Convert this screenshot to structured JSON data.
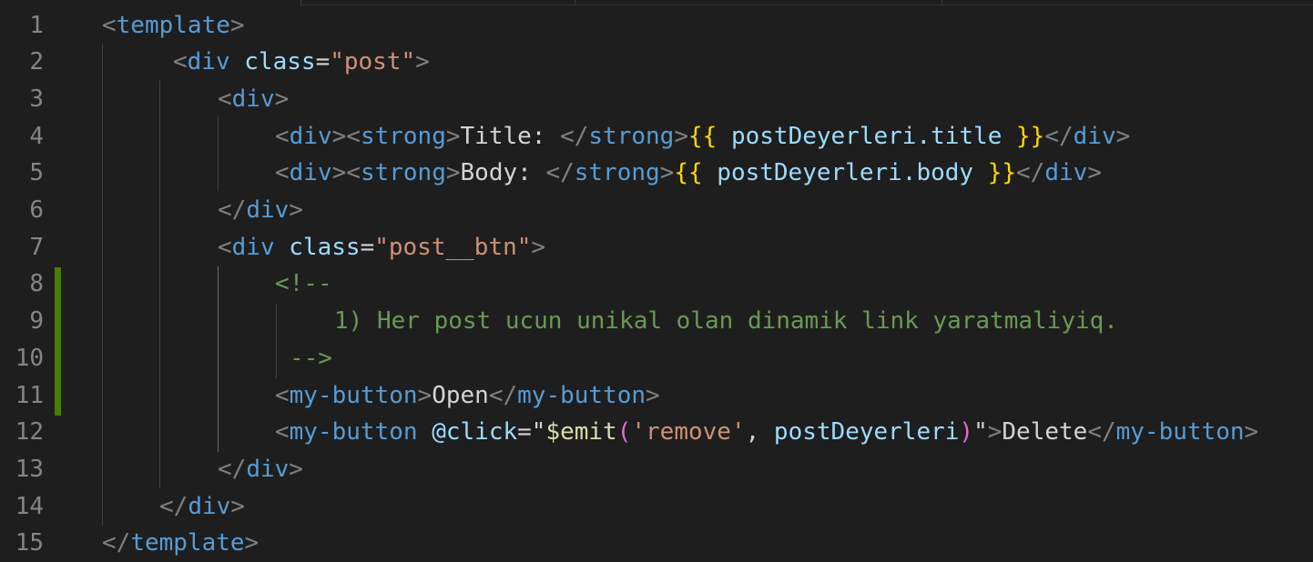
{
  "line_numbers": [
    "1",
    "2",
    "3",
    "4",
    "5",
    "6",
    "7",
    "8",
    "9",
    "10",
    "11",
    "12",
    "13",
    "14",
    "15"
  ],
  "lines": [
    [
      {
        "t": "<",
        "c": "t-bracket"
      },
      {
        "t": "template",
        "c": "t-tag"
      },
      {
        "t": ">",
        "c": "t-bracket"
      }
    ],
    [
      {
        "t": "<",
        "c": "t-bracket"
      },
      {
        "t": "div",
        "c": "t-tag"
      },
      {
        "t": " ",
        "c": "t-text"
      },
      {
        "t": "class",
        "c": "t-attr"
      },
      {
        "t": "=",
        "c": "t-text"
      },
      {
        "t": "\"post\"",
        "c": "t-str"
      },
      {
        "t": ">",
        "c": "t-bracket"
      }
    ],
    [
      {
        "t": "<",
        "c": "t-bracket"
      },
      {
        "t": "div",
        "c": "t-tag"
      },
      {
        "t": ">",
        "c": "t-bracket"
      }
    ],
    [
      {
        "t": "<",
        "c": "t-bracket"
      },
      {
        "t": "div",
        "c": "t-tag"
      },
      {
        "t": "><",
        "c": "t-bracket"
      },
      {
        "t": "strong",
        "c": "t-tag"
      },
      {
        "t": ">",
        "c": "t-bracket"
      },
      {
        "t": "Title: ",
        "c": "t-text"
      },
      {
        "t": "</",
        "c": "t-bracket"
      },
      {
        "t": "strong",
        "c": "t-tag"
      },
      {
        "t": ">",
        "c": "t-bracket"
      },
      {
        "t": "{{",
        "c": "t-mus"
      },
      {
        "t": " postDeyerleri.title ",
        "c": "t-var"
      },
      {
        "t": "}}",
        "c": "t-mus"
      },
      {
        "t": "</",
        "c": "t-bracket"
      },
      {
        "t": "div",
        "c": "t-tag"
      },
      {
        "t": ">",
        "c": "t-bracket"
      }
    ],
    [
      {
        "t": "<",
        "c": "t-bracket"
      },
      {
        "t": "div",
        "c": "t-tag"
      },
      {
        "t": "><",
        "c": "t-bracket"
      },
      {
        "t": "strong",
        "c": "t-tag"
      },
      {
        "t": ">",
        "c": "t-bracket"
      },
      {
        "t": "Body: ",
        "c": "t-text"
      },
      {
        "t": "</",
        "c": "t-bracket"
      },
      {
        "t": "strong",
        "c": "t-tag"
      },
      {
        "t": ">",
        "c": "t-bracket"
      },
      {
        "t": "{{",
        "c": "t-mus"
      },
      {
        "t": " postDeyerleri.body ",
        "c": "t-var"
      },
      {
        "t": "}}",
        "c": "t-mus"
      },
      {
        "t": "</",
        "c": "t-bracket"
      },
      {
        "t": "div",
        "c": "t-tag"
      },
      {
        "t": ">",
        "c": "t-bracket"
      }
    ],
    [
      {
        "t": "</",
        "c": "t-bracket"
      },
      {
        "t": "div",
        "c": "t-tag"
      },
      {
        "t": ">",
        "c": "t-bracket"
      }
    ],
    [
      {
        "t": "<",
        "c": "t-bracket"
      },
      {
        "t": "div",
        "c": "t-tag"
      },
      {
        "t": " ",
        "c": "t-text"
      },
      {
        "t": "class",
        "c": "t-attr"
      },
      {
        "t": "=",
        "c": "t-text"
      },
      {
        "t": "\"post__btn\"",
        "c": "t-str"
      },
      {
        "t": ">",
        "c": "t-bracket"
      }
    ],
    [
      {
        "t": "<!--",
        "c": "t-com"
      }
    ],
    [
      {
        "t": "1) Her post ucun unikal olan dinamik link yaratmaliyiq.",
        "c": "t-com"
      }
    ],
    [
      {
        "t": "-->",
        "c": "t-com"
      }
    ],
    [
      {
        "t": "<",
        "c": "t-bracket"
      },
      {
        "t": "my-button",
        "c": "t-tag"
      },
      {
        "t": ">",
        "c": "t-bracket"
      },
      {
        "t": "Open",
        "c": "t-text"
      },
      {
        "t": "</",
        "c": "t-bracket"
      },
      {
        "t": "my-button",
        "c": "t-tag"
      },
      {
        "t": ">",
        "c": "t-bracket"
      }
    ],
    [
      {
        "t": "<",
        "c": "t-bracket"
      },
      {
        "t": "my-button",
        "c": "t-tag"
      },
      {
        "t": " ",
        "c": "t-text"
      },
      {
        "t": "@click",
        "c": "t-attr"
      },
      {
        "t": "=\"",
        "c": "t-text"
      },
      {
        "t": "$emit",
        "c": "t-fn"
      },
      {
        "t": "(",
        "c": "t-paren"
      },
      {
        "t": "'remove'",
        "c": "t-str"
      },
      {
        "t": ", ",
        "c": "t-text"
      },
      {
        "t": "postDeyerleri",
        "c": "t-var"
      },
      {
        "t": ")",
        "c": "t-paren"
      },
      {
        "t": "\"",
        "c": "t-text"
      },
      {
        "t": ">",
        "c": "t-bracket"
      },
      {
        "t": "Delete",
        "c": "t-text"
      },
      {
        "t": "</",
        "c": "t-bracket"
      },
      {
        "t": "my-button",
        "c": "t-tag"
      },
      {
        "t": ">",
        "c": "t-bracket"
      }
    ],
    [
      {
        "t": "</",
        "c": "t-bracket"
      },
      {
        "t": "div",
        "c": "t-tag"
      },
      {
        "t": ">",
        "c": "t-bracket"
      }
    ],
    [
      {
        "t": "</",
        "c": "t-bracket"
      },
      {
        "t": "div",
        "c": "t-tag"
      },
      {
        "t": ">",
        "c": "t-bracket"
      }
    ],
    [
      {
        "t": "</",
        "c": "t-bracket"
      },
      {
        "t": "template",
        "c": "t-tag"
      },
      {
        "t": ">",
        "c": "t-bracket"
      }
    ]
  ],
  "colors": {
    "background": "#1e1e1e",
    "line_number": "#858585",
    "tag": "#569cd6",
    "attribute": "#9cdcfe",
    "string": "#ce9178",
    "comment": "#6a9955",
    "mustache": "#ffd700",
    "function": "#dcdcaa",
    "paren": "#da70d6",
    "git_added_marker": "#487e02"
  }
}
